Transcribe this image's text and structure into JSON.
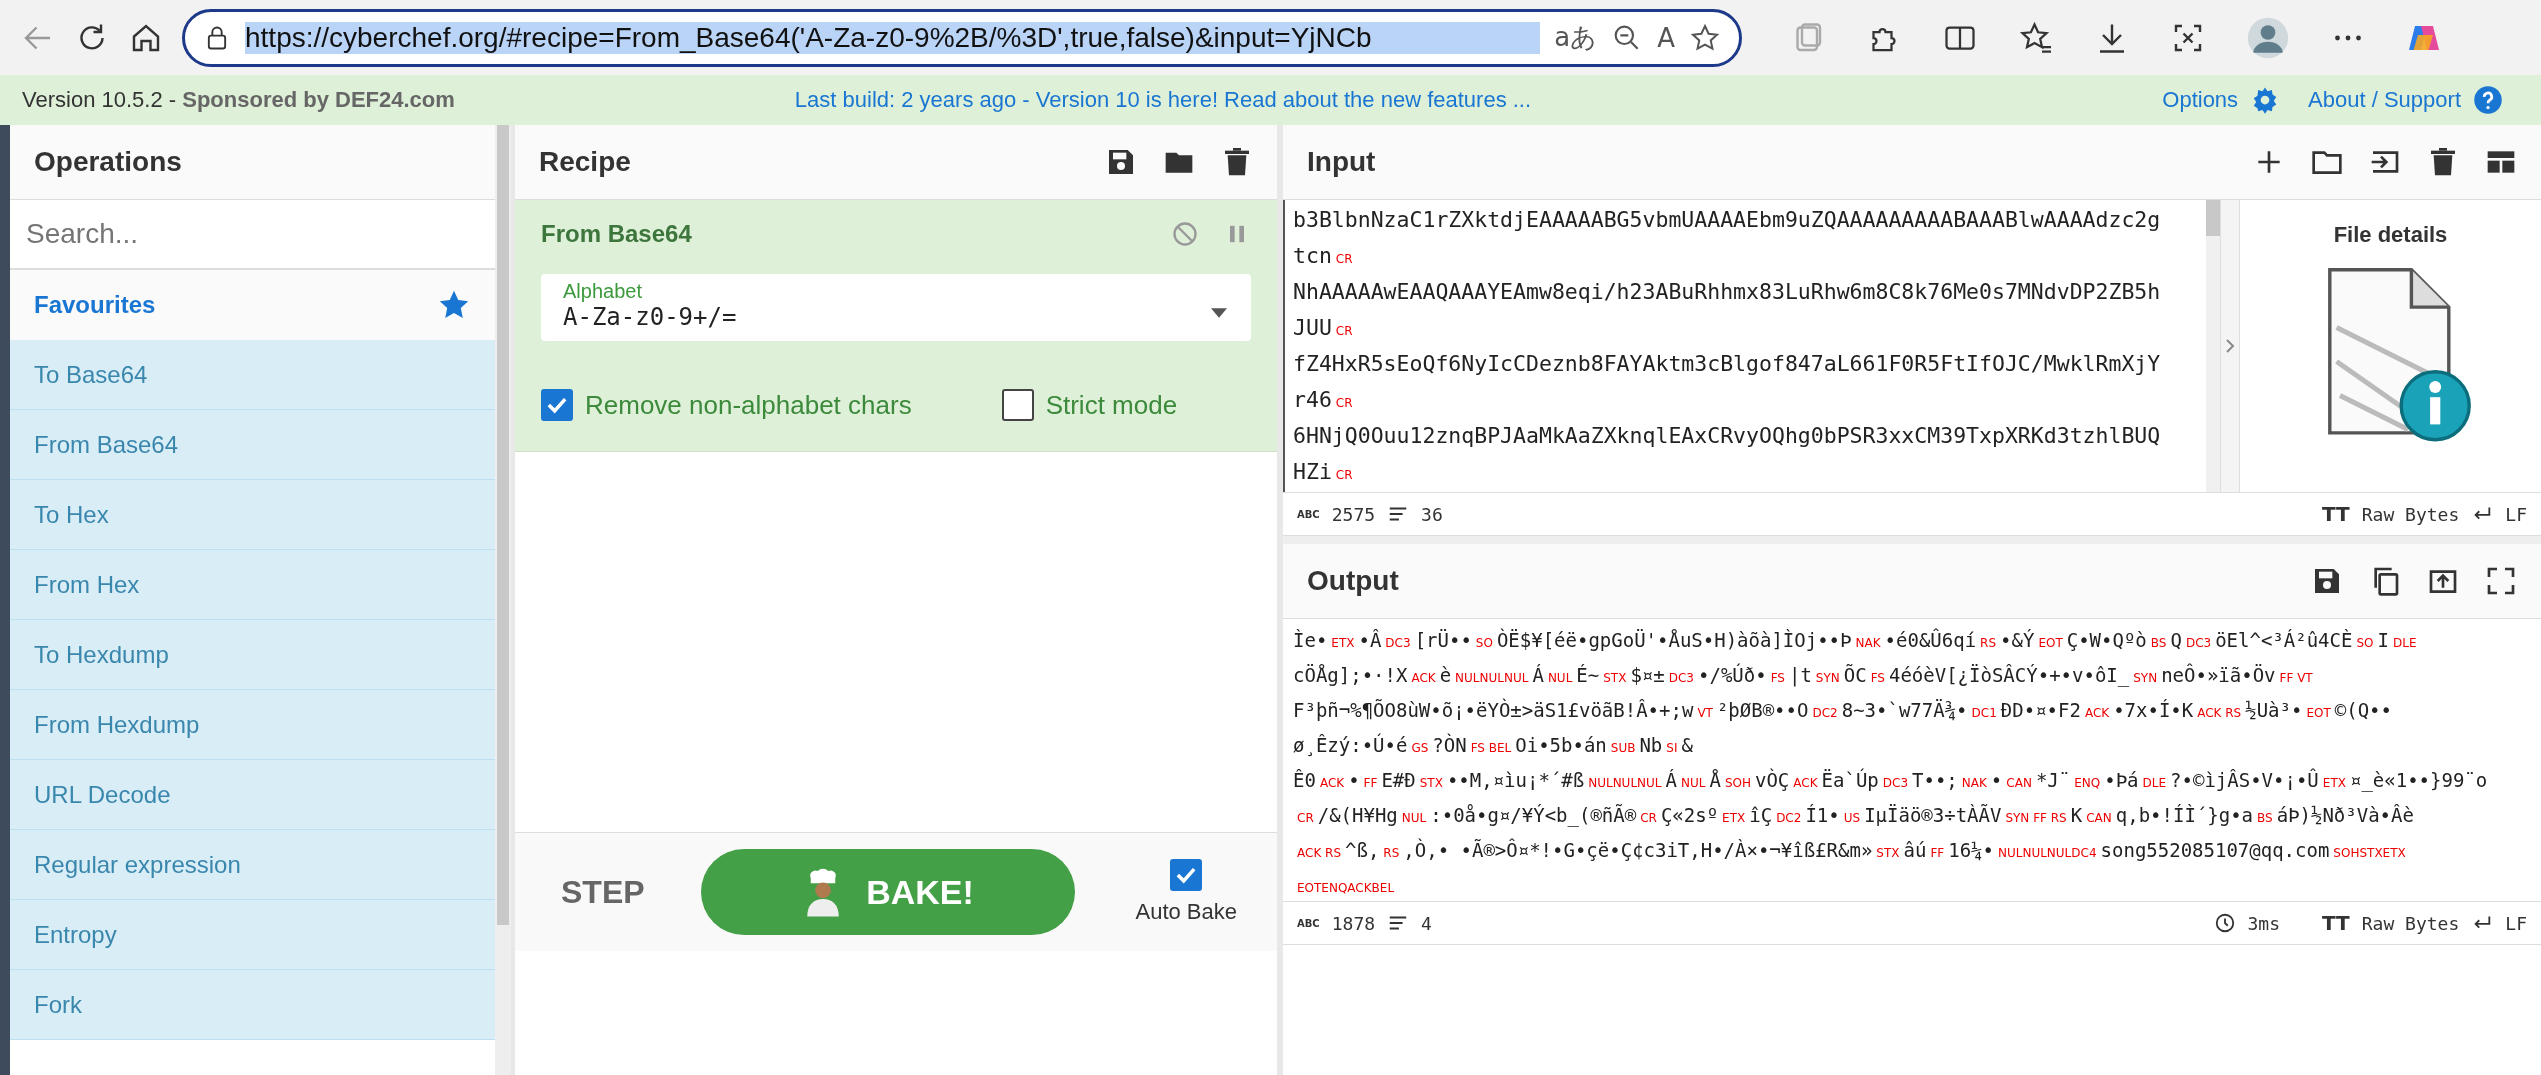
{
  "browser": {
    "url": "https://cyberchef.org/#recipe=From_Base64('A-Za-z0-9%2B/%3D',true,false)&input=YjNCb",
    "translate": "aあ",
    "read_aloud": "A"
  },
  "banner": {
    "version": "Version 10.5.2 - ",
    "sponsor_label": "Sponsored by",
    "sponsor": "DEF24.com",
    "notice": "Last build: 2 years ago - Version 10 is here! Read about the new features ...",
    "options": "Options",
    "about": "About / Support"
  },
  "operations": {
    "title": "Operations",
    "search": {
      "placeholder": "Search..."
    },
    "category": "Favourites",
    "items": [
      "To Base64",
      "From Base64",
      "To Hex",
      "From Hex",
      "To Hexdump",
      "From Hexdump",
      "URL Decode",
      "Regular expression",
      "Entropy",
      "Fork"
    ]
  },
  "recipe": {
    "title": "Recipe",
    "operation": {
      "name": "From Base64",
      "alphabet": {
        "label": "Alphabet",
        "value": "A-Za-z0-9+/="
      },
      "options": [
        {
          "label": "Remove non-alphabet chars",
          "checked": true
        },
        {
          "label": "Strict mode",
          "checked": false
        }
      ]
    }
  },
  "controls": {
    "step": "STEP",
    "bake": "BAKE!",
    "auto_bake": {
      "label": "Auto Bake",
      "checked": true
    }
  },
  "input": {
    "title": "Input",
    "rows": [
      {
        "text": "b3BlbnNzaC1rZXktdjEAAAAABG5vbmUAAAAEbm9uZQAAAAAAAAABAAABlwAAAAdzc2g"
      },
      {
        "text": "tcn",
        "line_end": "CR"
      },
      {
        "text": "NhAAAAAwEAAQAAAYEAmw8eqi/h23ABuRhhmx83LuRhw6m8C8k76Me0s7MNdvDP2ZB5h"
      },
      {
        "text": "JUU",
        "line_end": "CR"
      },
      {
        "text": "fZ4HxR5sEoQf6NyIcCDeznb8FAYAktm3cBlgof847aL661F0R5FtIfOJC/MwklRmXjY"
      },
      {
        "text": "r46",
        "line_end": "CR"
      },
      {
        "text": "6HNjQ0Ouu12znqBPJAaMkAaZXknqlEAxCRvyOQhg0bPSR3xxCM39TxpXRKd3tzhlBUQ"
      },
      {
        "text": "HZi",
        "line_end": "CR"
      }
    ],
    "file_details": "File details",
    "status": {
      "char_icon": "ABC",
      "chars": "2575",
      "lines": "36",
      "format_icon": "TT",
      "format": "Raw Bytes",
      "eol": "LF"
    }
  },
  "output": {
    "title": "Output",
    "lines": [
      [
        {
          "kind": "text",
          "text": "Ìe•"
        },
        {
          "kind": "control",
          "text": "ETX"
        },
        {
          "kind": "text",
          "text": "•Â"
        },
        {
          "kind": "control",
          "text": "DC3"
        },
        {
          "kind": "text",
          "text": "[rÜ••"
        },
        {
          "kind": "control",
          "text": "SO"
        },
        {
          "kind": "text",
          "text": "ÒË$¥[éë•gpGoÜ'•ÅuS•H)àõà]ÌOj••Þ"
        },
        {
          "kind": "control",
          "text": "NAK"
        },
        {
          "kind": "text",
          "text": "•é0&Û6qí"
        },
        {
          "kind": "control",
          "text": "RS"
        },
        {
          "kind": "text",
          "text": "•&Ý"
        },
        {
          "kind": "control",
          "text": "EOT"
        },
        {
          "kind": "text",
          "text": "Ç•W•Qºò"
        },
        {
          "kind": "control",
          "text": "BS"
        },
        {
          "kind": "text",
          "text": "Q"
        },
        {
          "kind": "control",
          "text": "DC3"
        },
        {
          "kind": "text",
          "text": "öEl^<³Á²û4CÈ"
        },
        {
          "kind": "control",
          "text": "SO"
        },
        {
          "kind": "text",
          "text": "I"
        },
        {
          "kind": "control",
          "text": "DLE"
        }
      ],
      [
        {
          "kind": "text",
          "text": "cÖÅg];•·!X"
        },
        {
          "kind": "control",
          "text": "ACK"
        },
        {
          "kind": "text",
          "text": "è"
        },
        {
          "kind": "control",
          "text": "NULNULNUL"
        },
        {
          "kind": "text",
          "text": "Á"
        },
        {
          "kind": "control",
          "text": "NUL"
        },
        {
          "kind": "text",
          "text": "É~"
        },
        {
          "kind": "control",
          "text": "STX"
        },
        {
          "kind": "text",
          "text": "$¤±"
        },
        {
          "kind": "control",
          "text": "DC3"
        },
        {
          "kind": "text",
          "text": "•/%Úð•"
        },
        {
          "kind": "control",
          "text": "FS"
        },
        {
          "kind": "text",
          "text": "|t"
        },
        {
          "kind": "control",
          "text": "SYN"
        },
        {
          "kind": "text",
          "text": "ÕC"
        },
        {
          "kind": "control",
          "text": "FS"
        },
        {
          "kind": "text",
          "text": "4éóèV[¿ÏòSÂCÝ•+•v•ôI_"
        },
        {
          "kind": "control",
          "text": "SYN"
        },
        {
          "kind": "text",
          "text": "neÔ•»ïã•Öv"
        },
        {
          "kind": "control",
          "text": "FF VT"
        }
      ],
      [
        {
          "kind": "text",
          "text": "F³þñ¬%¶ÕO8ùW•õ¡•ëYÒ±>äS1£vöãB!Â"
        },
        {
          "kind": "text",
          "text": "•+;w"
        },
        {
          "kind": "control",
          "text": "VT"
        },
        {
          "kind": "text",
          "text": "²þØB®••O"
        },
        {
          "kind": "control",
          "text": "DC2"
        },
        {
          "kind": "text",
          "text": "8~3•`w77Ä¾•"
        },
        {
          "kind": "control",
          "text": "DC1"
        },
        {
          "kind": "text",
          "text": "ÐD•¤•F2"
        },
        {
          "kind": "control",
          "text": "ACK"
        },
        {
          "kind": "text",
          "text": "•7x•Í•K"
        },
        {
          "kind": "control",
          "text": "ACK RS"
        },
        {
          "kind": "text",
          "text": "½Uà³•"
        },
        {
          "kind": "control",
          "text": "EOT"
        },
        {
          "kind": "text",
          "text": "©(Q••"
        }
      ],
      [
        {
          "kind": "text",
          "text": "ø¸Êzý:•Ú•é"
        },
        {
          "kind": "control",
          "text": "GS"
        },
        {
          "kind": "text",
          "text": "?ÒN"
        },
        {
          "kind": "control",
          "text": "FS BEL"
        },
        {
          "kind": "text",
          "text": "Oi•5b•án"
        },
        {
          "kind": "control",
          "text": "SUB"
        },
        {
          "kind": "text",
          "text": "Nb"
        },
        {
          "kind": "control",
          "text": "SI"
        },
        {
          "kind": "text",
          "text": "&"
        }
      ],
      [
        {
          "kind": "text",
          "text": "Ê0"
        },
        {
          "kind": "control",
          "text": "ACK"
        },
        {
          "kind": "text",
          "text": "•"
        },
        {
          "kind": "control",
          "text": "FF"
        },
        {
          "kind": "text",
          "text": "E#Ð"
        },
        {
          "kind": "control",
          "text": "STX"
        },
        {
          "kind": "text",
          "text": "••M,¤ìu¡*´#ß"
        },
        {
          "kind": "control",
          "text": "NULNULNUL"
        },
        {
          "kind": "text",
          "text": "Á"
        },
        {
          "kind": "control",
          "text": "NUL"
        },
        {
          "kind": "text",
          "text": "Å"
        },
        {
          "kind": "control",
          "text": "SOH"
        },
        {
          "kind": "text",
          "text": "vÒÇ"
        },
        {
          "kind": "control",
          "text": "ACK"
        },
        {
          "kind": "text",
          "text": "Ëa`Úp"
        },
        {
          "kind": "control",
          "text": "DC3"
        },
        {
          "kind": "text",
          "text": "T••;"
        },
        {
          "kind": "control",
          "text": "NAK"
        },
        {
          "kind": "text",
          "text": "•"
        },
        {
          "kind": "control",
          "text": "CAN"
        },
        {
          "kind": "text",
          "text": "*J¨"
        },
        {
          "kind": "control",
          "text": "ENQ"
        },
        {
          "kind": "text",
          "text": "•Þá"
        },
        {
          "kind": "control",
          "text": "DLE"
        },
        {
          "kind": "text",
          "text": "?•©ìjÂS•V•¡•Û"
        },
        {
          "kind": "control",
          "text": "ETX"
        },
        {
          "kind": "text",
          "text": "¤_è«1••}99¨o"
        }
      ],
      [
        {
          "kind": "control",
          "text": "CR"
        },
        {
          "kind": "text",
          "text": "/&(H¥Hg"
        },
        {
          "kind": "control",
          "text": "NUL"
        },
        {
          "kind": "text",
          "text": ":•0å•g¤/¥Ý<b_(®ñÃ"
        },
        {
          "kind": "text",
          "text": "®"
        },
        {
          "kind": "control",
          "text": "CR"
        },
        {
          "kind": "text",
          "text": "Ç«2sº"
        },
        {
          "kind": "control",
          "text": "ETX"
        },
        {
          "kind": "text",
          "text": "îÇ"
        },
        {
          "kind": "control",
          "text": "DC2"
        },
        {
          "kind": "text",
          "text": "Í1•"
        },
        {
          "kind": "control",
          "text": "US"
        },
        {
          "kind": "text",
          "text": "IµÏäö®3÷tÀÃV"
        },
        {
          "kind": "control",
          "text": "SYN FF RS"
        },
        {
          "kind": "text",
          "text": "K"
        },
        {
          "kind": "control",
          "text": "CAN"
        },
        {
          "kind": "text",
          "text": "q,b•!ÍÌ´}g•a"
        },
        {
          "kind": "control",
          "text": "BS"
        },
        {
          "kind": "text",
          "text": "áÞ)½Nð³Và•Âè"
        }
      ],
      [
        {
          "kind": "control",
          "text": "ACK RS"
        },
        {
          "kind": "text",
          "text": "^ß,"
        },
        {
          "kind": "control",
          "text": "RS"
        },
        {
          "kind": "text",
          "text": ",Ò,• •Ã"
        },
        {
          "kind": "text",
          "text": "®>Ô¤*!•G•çë•Ç¢c3iT,H•/À×•¬¥îß£R&m»"
        },
        {
          "kind": "control",
          "text": "STX"
        },
        {
          "kind": "text",
          "text": "âú"
        },
        {
          "kind": "control",
          "text": "FF"
        },
        {
          "kind": "text",
          "text": "16¼•"
        },
        {
          "kind": "control",
          "text": "NULNULNULDC4"
        },
        {
          "kind": "text",
          "text": "song552085107@qq.com"
        },
        {
          "kind": "control",
          "text": "SOHSTXETX"
        }
      ],
      [
        {
          "kind": "control",
          "text": "EOTENQACKBEL"
        }
      ]
    ],
    "status": {
      "char_icon": "ABC",
      "chars": "1878",
      "lines": "4",
      "time": "3ms",
      "format_icon": "TT",
      "format": "Raw Bytes",
      "eol": "LF"
    }
  }
}
